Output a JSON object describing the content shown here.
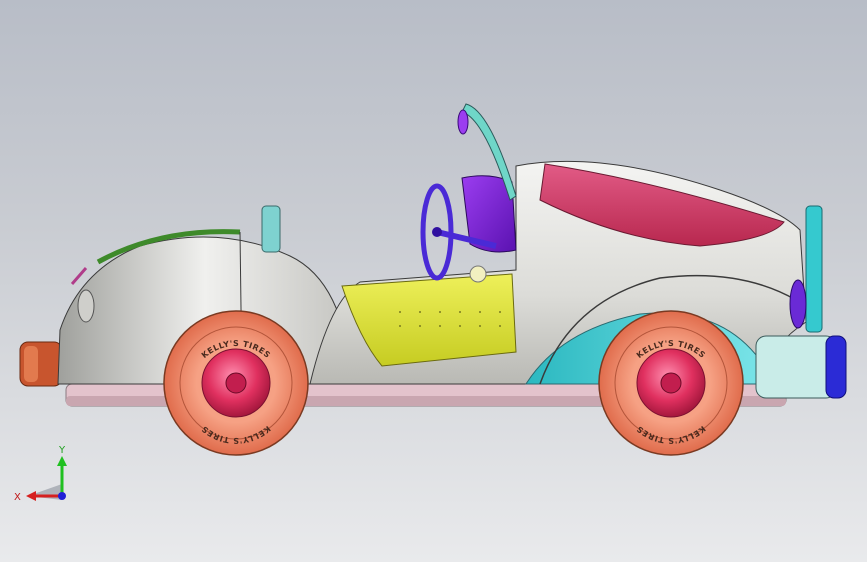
{
  "viewport": {
    "background_top": "#b8bdc7",
    "background_bottom": "#e9eaec"
  },
  "model": {
    "tire_text": "KELLY'S TIRES",
    "colors": {
      "body": "#e6e6e2",
      "pink_panel": "#d9416f",
      "yellow_door": "#dde33c",
      "purple_seat": "#7a22d6",
      "cyan_trim": "#35c9cf",
      "tire": "#f08a6a",
      "hub": "#e23a6a",
      "bumper_rear": "#c8552e",
      "bumper_front": "#2b2bd6"
    }
  },
  "triad": {
    "x_label": "X",
    "y_label": "Y",
    "x_color": "#d62020",
    "y_color": "#20c020",
    "z_color": "#2020d6"
  }
}
